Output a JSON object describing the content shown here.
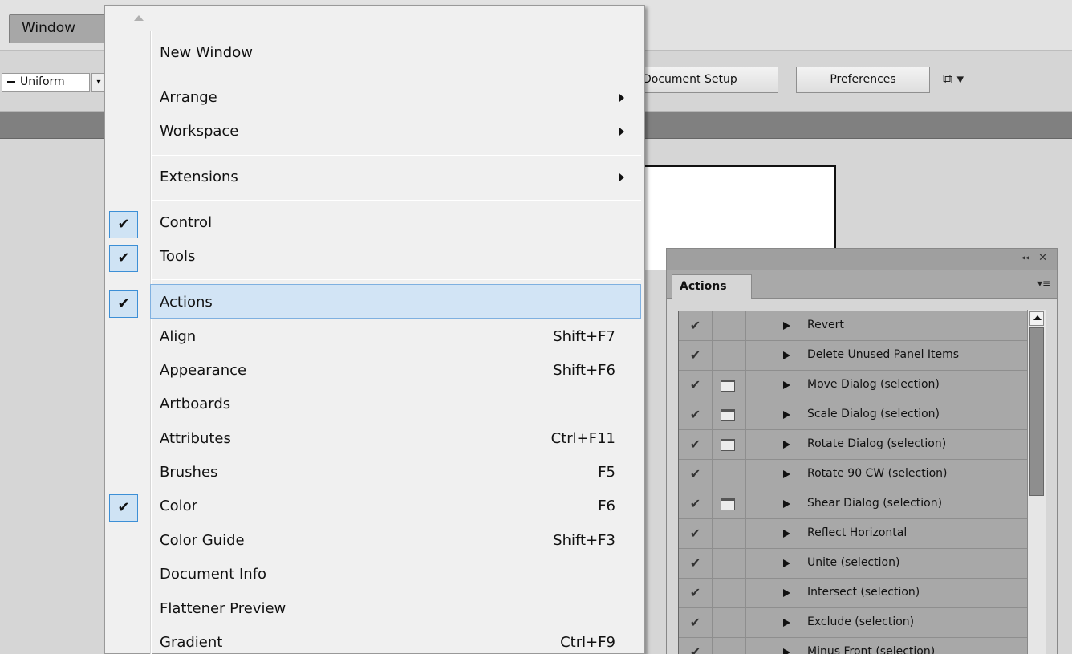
{
  "menubar": {
    "window_label": "Window"
  },
  "controlbar": {
    "stroke_profile": "Uniform",
    "document_setup": "Document Setup",
    "preferences": "Preferences",
    "arrange_icon": "arrange-documents-icon"
  },
  "window_menu": {
    "items": [
      {
        "label": "New Window",
        "shortcut": "",
        "submenu": false,
        "checked": false
      },
      {
        "label": "Arrange",
        "shortcut": "",
        "submenu": true,
        "checked": false
      },
      {
        "label": "Workspace",
        "shortcut": "",
        "submenu": true,
        "checked": false
      },
      {
        "label": "Extensions",
        "shortcut": "",
        "submenu": true,
        "checked": false
      },
      {
        "label": "Control",
        "shortcut": "",
        "submenu": false,
        "checked": true
      },
      {
        "label": "Tools",
        "shortcut": "",
        "submenu": false,
        "checked": true
      },
      {
        "label": "Actions",
        "shortcut": "",
        "submenu": false,
        "checked": true,
        "highlighted": true
      },
      {
        "label": "Align",
        "shortcut": "Shift+F7",
        "submenu": false,
        "checked": false
      },
      {
        "label": "Appearance",
        "shortcut": "Shift+F6",
        "submenu": false,
        "checked": false
      },
      {
        "label": "Artboards",
        "shortcut": "",
        "submenu": false,
        "checked": false
      },
      {
        "label": "Attributes",
        "shortcut": "Ctrl+F11",
        "submenu": false,
        "checked": false
      },
      {
        "label": "Brushes",
        "shortcut": "F5",
        "submenu": false,
        "checked": false
      },
      {
        "label": "Color",
        "shortcut": "F6",
        "submenu": false,
        "checked": true
      },
      {
        "label": "Color Guide",
        "shortcut": "Shift+F3",
        "submenu": false,
        "checked": false
      },
      {
        "label": "Document Info",
        "shortcut": "",
        "submenu": false,
        "checked": false
      },
      {
        "label": "Flattener Preview",
        "shortcut": "",
        "submenu": false,
        "checked": false
      },
      {
        "label": "Gradient",
        "shortcut": "Ctrl+F9",
        "submenu": false,
        "checked": false
      }
    ]
  },
  "actions_panel": {
    "tab_label": "Actions",
    "collapse_icon": "collapse-panel-icon",
    "close_icon": "close-icon",
    "menu_icon": "panel-menu-icon",
    "actions": [
      {
        "name": "Revert",
        "dialog": false
      },
      {
        "name": "Delete Unused Panel Items",
        "dialog": false
      },
      {
        "name": "Move Dialog (selection)",
        "dialog": true
      },
      {
        "name": "Scale Dialog (selection)",
        "dialog": true
      },
      {
        "name": "Rotate Dialog (selection)",
        "dialog": true
      },
      {
        "name": "Rotate 90 CW (selection)",
        "dialog": false
      },
      {
        "name": "Shear Dialog (selection)",
        "dialog": true
      },
      {
        "name": "Reflect Horizontal",
        "dialog": false
      },
      {
        "name": "Unite (selection)",
        "dialog": false
      },
      {
        "name": "Intersect (selection)",
        "dialog": false
      },
      {
        "name": "Exclude (selection)",
        "dialog": false
      },
      {
        "name": "Minus Front (selection)",
        "dialog": false
      }
    ]
  }
}
